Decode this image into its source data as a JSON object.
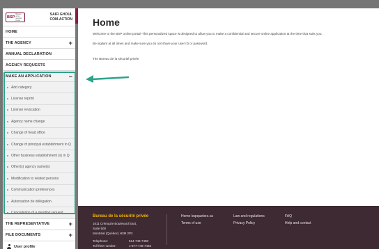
{
  "sidebar": {
    "brand": {
      "logo_text": "BSP",
      "logo_subtext": "Bureau de la sécurité privée",
      "user_line1": "SAIFI GHOUL",
      "user_line2": "COM-ACTION"
    },
    "items": [
      {
        "label": "HOME"
      },
      {
        "label": "THE AGENCY",
        "toggle": "+"
      },
      {
        "label": "ANNUAL DECLARATION"
      },
      {
        "label": "AGENCY REQUESTS"
      },
      {
        "label": "MAKE AN APPLICATION",
        "toggle": "−"
      }
    ],
    "application_items": [
      "Add category",
      "License reprint",
      "License revocation",
      "Agency name change",
      "Change of head office",
      "Change of principal establishment in Q",
      "Other business establishment (s) in Q",
      "Other(s) agency name(s)",
      "Modification to related persons",
      "Communication preferences",
      "Autorisation de délégation",
      "Cancellation of a pending request"
    ],
    "lower_items": [
      {
        "label": "THE REPRESENTATIVE",
        "toggle": "+"
      },
      {
        "label": "FILE DOCUMENTS",
        "toggle": "+"
      }
    ],
    "user_profile": "User profile"
  },
  "main": {
    "title": "Home",
    "welcome": "Welcome to the BSP online portal! This personalized space is designed to allow you to make a confidential and secure online application at the time that suits you.",
    "warning": "Be vigilant at all times and make sure you do not share your user ID or password.",
    "signature": "The Bureau de la sécurité privée"
  },
  "footer": {
    "org_name": "Bureau de la sécurité privée",
    "address1": "1611 Crémazie Boulevard East,",
    "address2": "Suite 500",
    "address3": "Montréal (Québec) H2M 2P2",
    "phone_label": "Telephone:",
    "phone": "514-748-7480",
    "tollfree_label": "Toll-free number:",
    "tollfree": "1-877-748-7483",
    "links": {
      "home": "Home bspquebec.ca",
      "terms": "Terms of use",
      "laws": "Law and regulations",
      "privacy": "Privacy Policy",
      "faq": "FAQ",
      "help": "Help and contact"
    }
  },
  "colors": {
    "accent": "#2ba58a",
    "brand": "#8b1e3f",
    "footer_bg": "#3d2a32",
    "footer_title": "#f5b400"
  }
}
